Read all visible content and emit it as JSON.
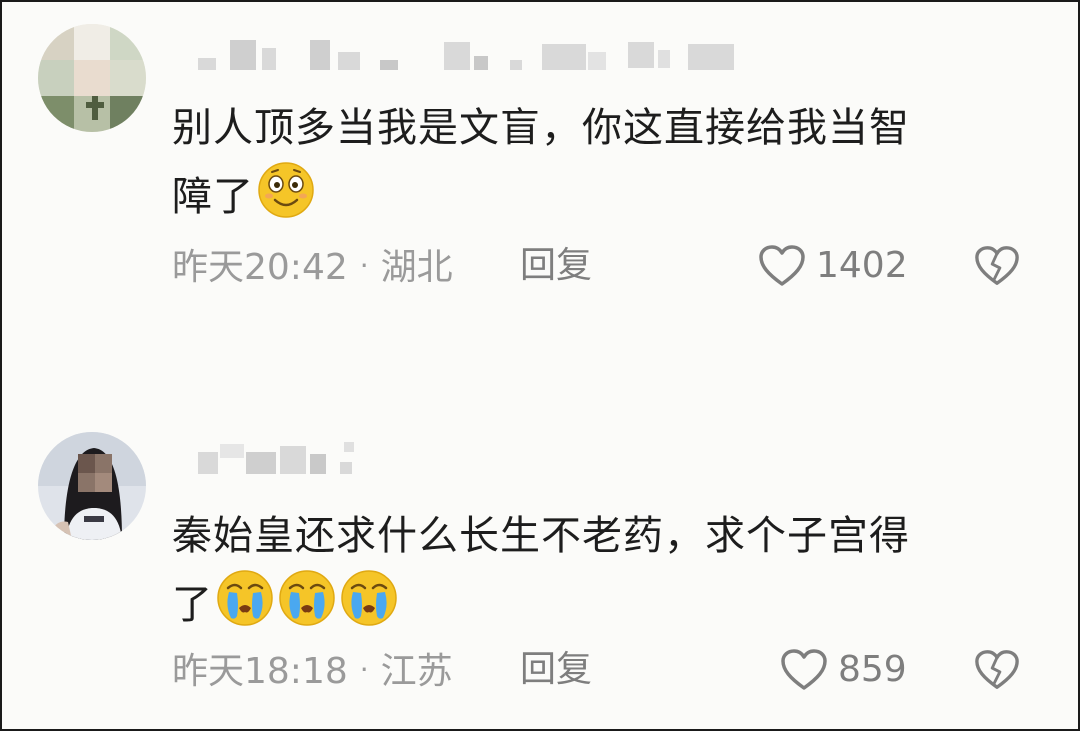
{
  "comments": [
    {
      "text_line1": "别人顶多当我是文盲，你这直接给我当智",
      "text_line2": "障了",
      "emojis": [
        "smile-emoji"
      ],
      "time": "昨天20:42",
      "separator": "·",
      "location": "湖北",
      "reply_label": "回复",
      "like_count": "1402"
    },
    {
      "text_line1": "秦始皇还求什么长生不老药，求个子宫得",
      "text_line2": "了",
      "emojis": [
        "crying-emoji",
        "crying-emoji",
        "crying-emoji"
      ],
      "time": "昨天18:18",
      "separator": "·",
      "location": "江苏",
      "reply_label": "回复",
      "like_count": "859"
    }
  ],
  "colors": {
    "text": "#1d1d1d",
    "meta": "#9a9a9a",
    "icon": "#7e7e7e",
    "emoji_face": "#f5c528",
    "tear": "#4aa8f0"
  }
}
